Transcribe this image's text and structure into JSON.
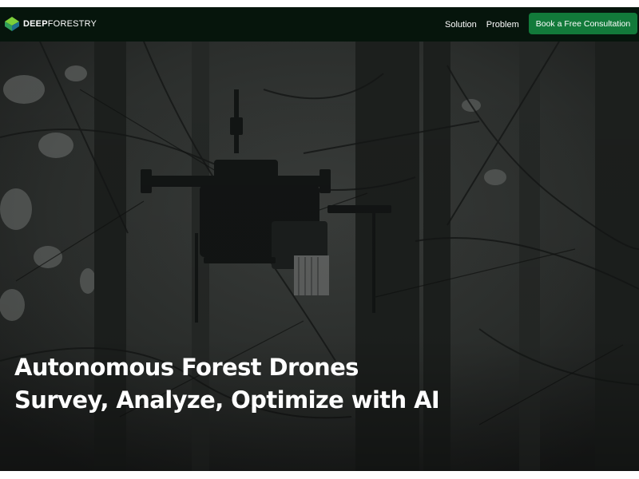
{
  "brand": {
    "name_bold": "DEEP",
    "name_light": "FORESTRY",
    "logo_icon": "layered-leaf-logo",
    "accent_color": "#127a3a",
    "logo_colors": [
      "#7ccf3a",
      "#2f9e5a",
      "#1f6f8b"
    ]
  },
  "nav": {
    "links": [
      {
        "label": "Solution"
      },
      {
        "label": "Problem"
      }
    ],
    "cta_label": "Book a Free Consultation",
    "background_color": "#06150c"
  },
  "hero": {
    "image": "drone-in-forest-photo",
    "title_line1": "Autonomous Forest Drones",
    "title_line2": "Survey, Analyze, Optimize with AI"
  }
}
